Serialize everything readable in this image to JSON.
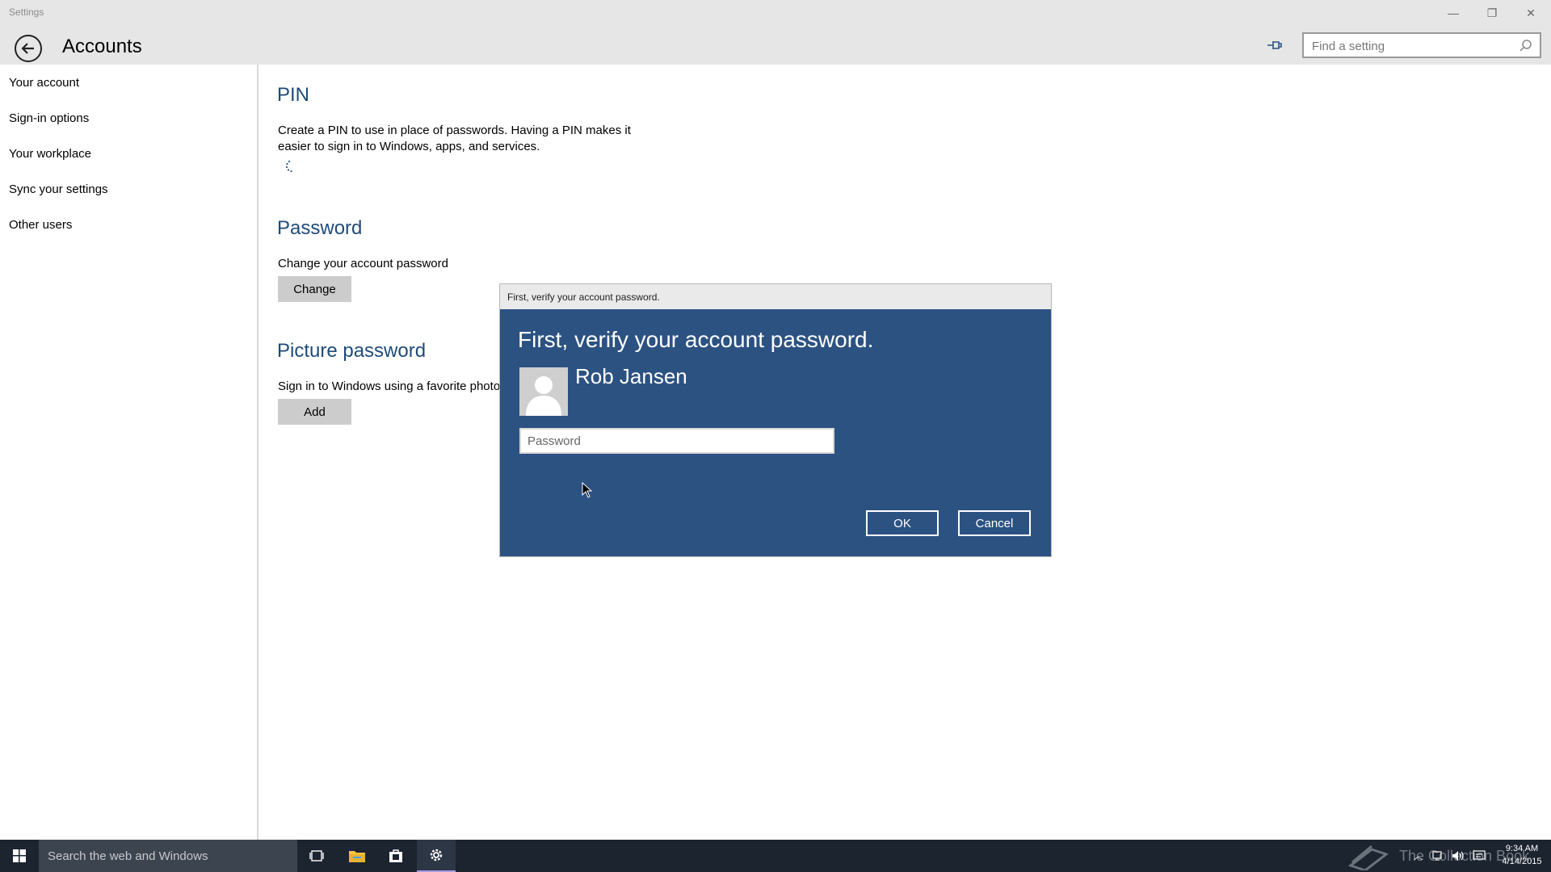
{
  "window": {
    "app_title": "Settings",
    "controls": {
      "minimize": "—",
      "restore": "❐",
      "close": "✕"
    }
  },
  "header": {
    "title": "Accounts",
    "search_placeholder": "Find a setting"
  },
  "sidebar": {
    "items": [
      {
        "label": "Your account"
      },
      {
        "label": "Sign-in options"
      },
      {
        "label": "Your workplace"
      },
      {
        "label": "Sync your settings"
      },
      {
        "label": "Other users"
      }
    ]
  },
  "main": {
    "pin": {
      "title": "PIN",
      "description_line1": "Create a PIN to use in place of passwords. Having a PIN makes it",
      "description_line2": "easier to sign in to Windows, apps, and services."
    },
    "password": {
      "title": "Password",
      "description": "Change your account password",
      "button": "Change"
    },
    "picture_password": {
      "title": "Picture password",
      "description": "Sign in to Windows using a favorite photo",
      "button": "Add"
    }
  },
  "dialog": {
    "window_title": "First, verify your account password.",
    "heading": "First, verify your account password.",
    "user_name": "Rob Jansen",
    "password_placeholder": "Password",
    "ok": "OK",
    "cancel": "Cancel",
    "accent_color": "#2c5282"
  },
  "taskbar": {
    "search_text": "Search the web and Windows",
    "watermark": "The Collection Book",
    "time": "9:34 AM",
    "date": "4/14/2015"
  }
}
